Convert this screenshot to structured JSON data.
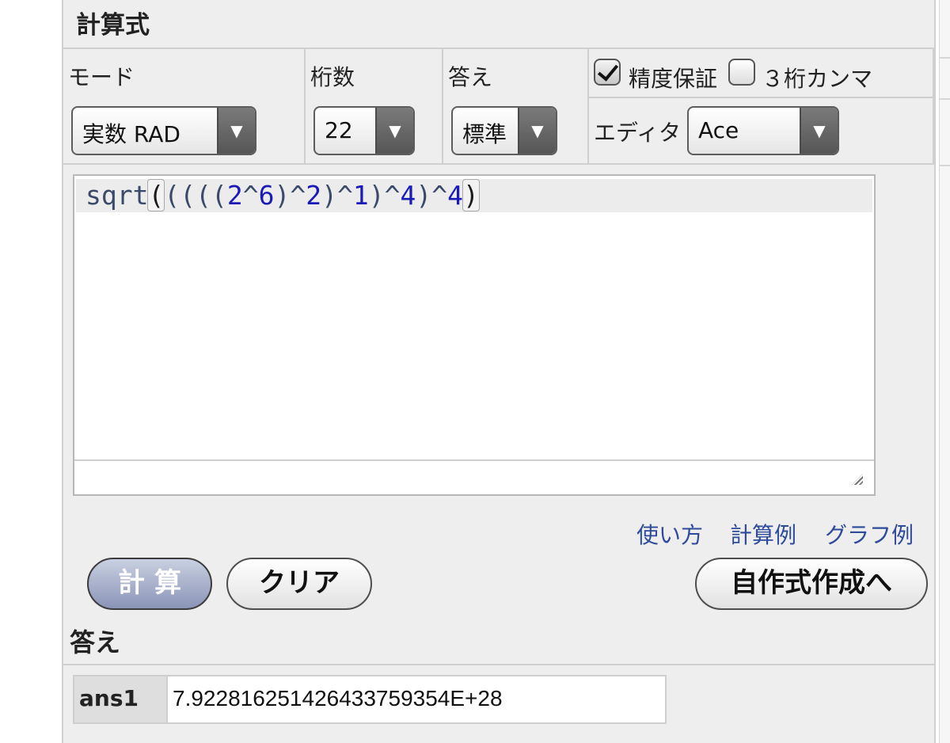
{
  "panel_title": "計算式",
  "mode": {
    "label": "モード",
    "value": "実数 RAD"
  },
  "digits": {
    "label": "桁数",
    "value": "22"
  },
  "answer_format": {
    "label": "答え",
    "value": "標準"
  },
  "precision_guarantee": {
    "label": "精度保証",
    "checked": true
  },
  "three_digit_comma": {
    "label": "３桁カンマ",
    "checked": false
  },
  "editor_select": {
    "label": "エディタ",
    "value": "Ace"
  },
  "expression": {
    "tokens": [
      {
        "t": "sqrt",
        "c": "fn"
      },
      {
        "t": "(",
        "c": "bracket"
      },
      {
        "t": "((((",
        "c": "op"
      },
      {
        "t": "2",
        "c": "num"
      },
      {
        "t": "^",
        "c": "op"
      },
      {
        "t": "6",
        "c": "num"
      },
      {
        "t": ")^",
        "c": "op"
      },
      {
        "t": "2",
        "c": "num"
      },
      {
        "t": ")^",
        "c": "op"
      },
      {
        "t": "1",
        "c": "num"
      },
      {
        "t": ")^",
        "c": "op"
      },
      {
        "t": "4",
        "c": "num"
      },
      {
        "t": ")^",
        "c": "op"
      },
      {
        "t": "4",
        "c": "num"
      },
      {
        "t": ")",
        "c": "bracket"
      }
    ]
  },
  "links": {
    "usage": "使い方",
    "examples": "計算例",
    "graph_examples": "グラフ例"
  },
  "buttons": {
    "calculate": "計算",
    "clear": "クリア",
    "custom_formula": "自作式作成へ"
  },
  "answer": {
    "title": "答え",
    "key": "ans1",
    "value": "7.922816251426433759354E+28"
  }
}
